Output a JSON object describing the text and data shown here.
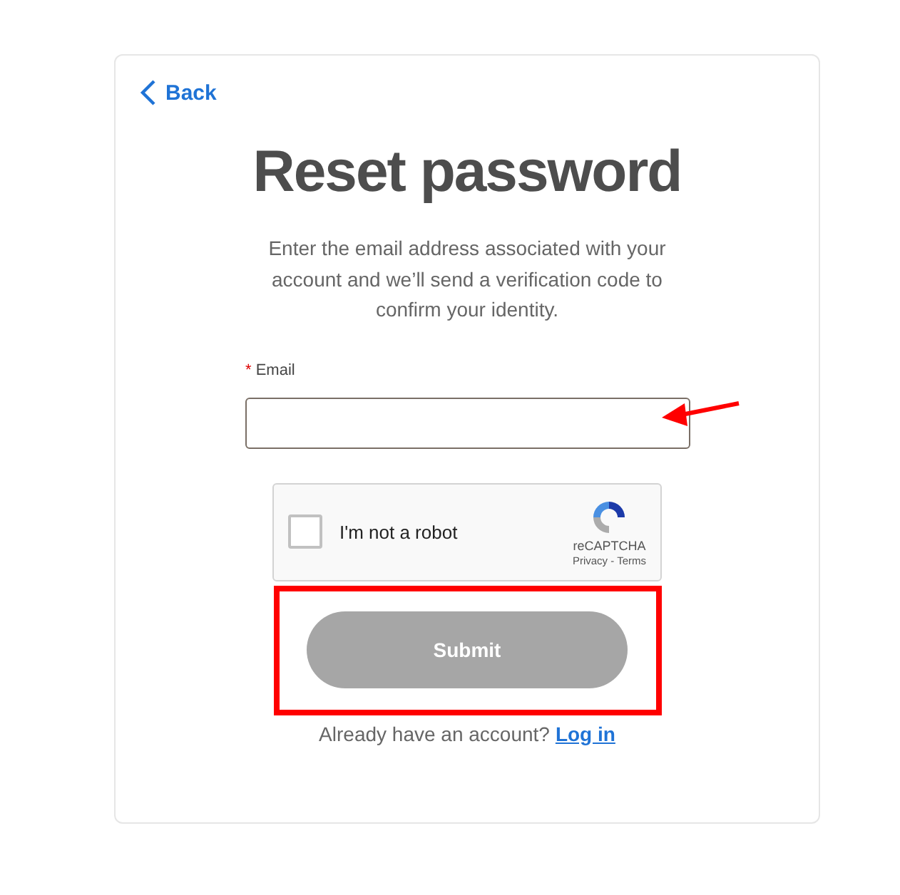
{
  "back_link": "Back",
  "title": "Reset password",
  "description": "Enter the email address associated with your account and we’ll send a verification code to confirm your identity.",
  "email_field": {
    "label": "Email",
    "required_mark": "*"
  },
  "captcha": {
    "label": "I'm not a robot",
    "checked": false,
    "brand": "reCAPTCHA",
    "privacy": "Privacy",
    "separator": "-",
    "terms": "Terms"
  },
  "submit_button": {
    "label": "Submit",
    "disabled": true
  },
  "footer": {
    "text": "Already have an account?",
    "link": "Log in"
  },
  "annotations": {
    "arrow": {
      "color": "#ff0000"
    },
    "frame": {
      "color": "#ff0000"
    }
  }
}
